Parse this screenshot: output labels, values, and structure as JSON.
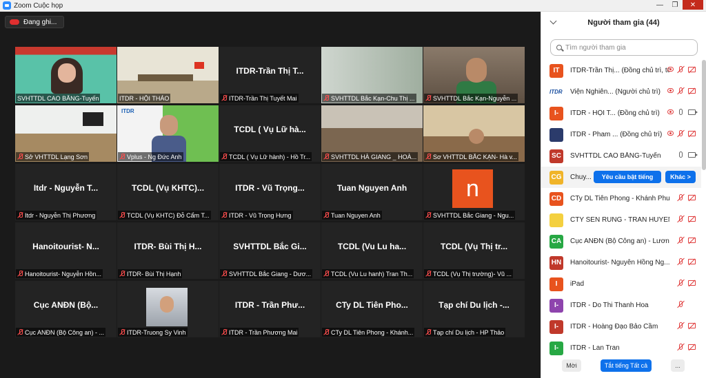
{
  "window": {
    "title": "Zoom Cuộc họp"
  },
  "recording": {
    "label": "Đang ghi..."
  },
  "tiles": [
    {
      "id": "t1",
      "label": "SVHTTDL CAO BẰNG-Tuyến",
      "muted": false,
      "video": true,
      "active": true
    },
    {
      "id": "t2",
      "label": "ITDR - HỘI THẢO",
      "muted": false,
      "video": true
    },
    {
      "id": "t3",
      "big": "ITDR-Trần Thị T...",
      "label": "ITDR-Trần Thị Tuyết Mai",
      "muted": true
    },
    {
      "id": "t4",
      "label": "SVHTTDL Bắc Kạn-Chu Thị ...",
      "muted": true,
      "video": true
    },
    {
      "id": "t5",
      "label": "SVHTTDL Bắc Kạn-Nguyễn ...",
      "muted": true,
      "video": true
    },
    {
      "id": "t6",
      "label": "Sở VHTTDL Lạng Sơn",
      "muted": true,
      "video": true
    },
    {
      "id": "t7",
      "label": "Vplus - Ng Đức Anh",
      "muted": true,
      "video": true
    },
    {
      "id": "t8",
      "big": "TCDL ( Vụ Lữ hà...",
      "label": "TCDL ( Vụ Lữ hành) - Hồ Tr...",
      "muted": true
    },
    {
      "id": "t9",
      "label": "SVHTTDL HÀ GIANG _ HOÀ...",
      "muted": true,
      "video": true
    },
    {
      "id": "t10",
      "label": "Sơ VHTTDL BẮC KẠN- Hà v...",
      "muted": true,
      "video": true
    },
    {
      "id": "t11",
      "big": "Itdr - Nguyễn T...",
      "label": "Itdr - Nguyễn Thị Phương",
      "muted": true
    },
    {
      "id": "t12",
      "big": "TCDL (Vụ KHTC)...",
      "label": "TCDL (Vụ KHTC) Đỗ Cẩm T...",
      "muted": true
    },
    {
      "id": "t13",
      "big": "ITDR - Vũ Trọng...",
      "label": "ITDR - Vũ Trọng Hưng",
      "muted": true
    },
    {
      "id": "t14",
      "big": "Tuan Nguyen Anh",
      "label": "Tuan Nguyen Anh",
      "muted": true
    },
    {
      "id": "t15",
      "avatar": "n",
      "label": "SVHTTDL Bắc Giang - Ngu...",
      "muted": true
    },
    {
      "id": "t16",
      "big": "Hanoitourist-  N...",
      "label": "Hanoitourist- Nguyễn Hồn...",
      "muted": true
    },
    {
      "id": "t17",
      "big": "ITDR- Bùi Thị H...",
      "label": "ITDR- Bùi Thị Hạnh",
      "muted": true
    },
    {
      "id": "t18",
      "big": "SVHTTDL Bắc Gi...",
      "label": "SVHTTDL Bắc Giang - Dươ...",
      "muted": true
    },
    {
      "id": "t19",
      "big": "TCDL (Vu Lu ha...",
      "label": "TCDL (Vu Lu hanh) Tran Th...",
      "muted": true
    },
    {
      "id": "t20",
      "big": "TCDL (Vụ Thị tr...",
      "label": "TCDL (Vụ Thị trường)- Vũ ...",
      "muted": true
    },
    {
      "id": "t21",
      "big": "Cục ANĐN  (Bộ...",
      "label": "Cục ANĐN (Bộ Công an) - ...",
      "muted": true
    },
    {
      "id": "t22",
      "photo": true,
      "label": "ITDR-Truong Sy Vinh",
      "muted": true
    },
    {
      "id": "t23",
      "big": "ITDR - Trần Phư...",
      "label": "ITDR - Trần Phương Mai",
      "muted": true
    },
    {
      "id": "t24",
      "big": "CTy DL Tiên Pho...",
      "label": "CTy DL Tiên Phong - Khánh...",
      "muted": true
    },
    {
      "id": "t25",
      "big": "Tạp chí Du lịch -...",
      "label": "Tạp chí Du lịch - HP Thảo",
      "muted": true
    }
  ],
  "panel": {
    "title": "Người tham gia (44)",
    "search_placeholder": "Tìm người tham gia",
    "participants": [
      {
        "initials": "IT",
        "color": "#e8531e",
        "name": "ITDR-Trần Thị... (Đồng chủ trì, tôi)",
        "rec": true,
        "mic": "off",
        "video": "off"
      },
      {
        "logo": "ITDR",
        "name": "Viện Nghiên... (Người chủ trì)",
        "rec": true,
        "mic": "off",
        "video": "off"
      },
      {
        "initials": "I-",
        "color": "#e8531e",
        "name": "ITDR - HỘI T... (Đồng chủ trì)",
        "rec": true,
        "mic": "on",
        "video": "on"
      },
      {
        "initials": "",
        "color": "#2b3b6b",
        "name": "ITDR - Pham ... (Đồng chủ trì)",
        "rec": true,
        "mic": "off",
        "video": "off"
      },
      {
        "initials": "SC",
        "color": "#c0392b",
        "name": "SVHTTDL CAO BẰNG-Tuyến",
        "mic": "on",
        "video": "on"
      },
      {
        "initials": "CG",
        "color": "#f0b429",
        "name": "Chuy...",
        "highlight": true
      },
      {
        "initials": "CD",
        "color": "#e8531e",
        "name": "CTy DL Tiên Phong - Khánh Phươ...",
        "mic": "off",
        "video": "off"
      },
      {
        "initials": "",
        "color": "#f4d03f",
        "name": "CTY SEN RUNG - TRAN HUYEN ...",
        "mic": "off",
        "video": "off"
      },
      {
        "initials": "CA",
        "color": "#27a844",
        "name": "Cục ANĐN (Bộ Công an) - Lươn...",
        "mic": "off",
        "video": "off"
      },
      {
        "initials": "HN",
        "color": "#c0392b",
        "name": "Hanoitourist- Nguyễn Hồng Ng...",
        "mic": "off",
        "video": "off"
      },
      {
        "initials": "I",
        "color": "#e8531e",
        "name": "iPad",
        "mic": "off",
        "video": "off"
      },
      {
        "initials": "I-",
        "color": "#8e44ad",
        "name": "ITDR - Do Thi Thanh Hoa",
        "mic": "off"
      },
      {
        "initials": "I-",
        "color": "#c0392b",
        "name": "ITDR - Hoàng Đạo Bảo Cầm",
        "mic": "off",
        "video": "off"
      },
      {
        "initials": "I-",
        "color": "#27a844",
        "name": "ITDR - Lan Tran",
        "mic": "off",
        "video": "off"
      }
    ],
    "unmute_request": "Yêu cầu bật tiếng",
    "more": "Khác >",
    "footer": {
      "invite": "Mời",
      "mute_all": "Tắt tiếng Tất cả",
      "more": "..."
    }
  }
}
